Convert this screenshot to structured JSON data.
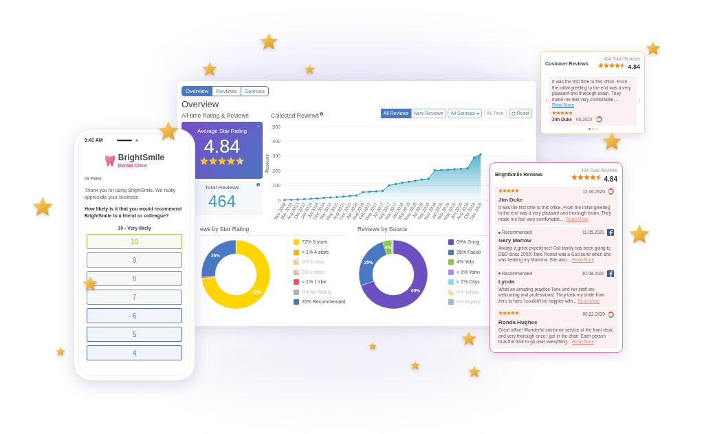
{
  "dashboard": {
    "tabs": [
      {
        "label": "Overview",
        "selected": true
      },
      {
        "label": "Reviews",
        "selected": false
      },
      {
        "label": "Sources",
        "selected": false
      }
    ],
    "heading": "Overview",
    "rating_title": "All-time Rating & Reviews",
    "average": {
      "label": "Average Star Rating",
      "value": "4.84",
      "stars": 4.5
    },
    "total": {
      "label": "Total Reviews",
      "value": "464"
    },
    "collected": {
      "title": "Collected Reviews",
      "filters": [
        {
          "label": "All Reviews",
          "kind": "toggle",
          "selected": true
        },
        {
          "label": "New Reviews",
          "kind": "toggle",
          "selected": false
        },
        {
          "label": "All Sources",
          "kind": "dropdown"
        },
        {
          "label": "All Time",
          "kind": "plain"
        },
        {
          "label": "Reset",
          "kind": "reset"
        }
      ],
      "chart_data": {
        "type": "area",
        "grid": true,
        "ylabel": "Reviews",
        "ylim": [
          0,
          500
        ],
        "yticks": [
          0,
          100,
          200,
          300,
          400,
          500
        ],
        "categories": [
          "Nov 2008",
          "Mar 2010",
          "Aug 2013",
          "Oct 2013",
          "Jan 2014",
          "Jul 2014",
          "Dec 2014",
          "Mar 2015",
          "May 2015",
          "Aug 2015",
          "Dec 2015",
          "Apr 2016",
          "Aug 2016",
          "Feb 2017",
          "May 2017",
          "Jul 2017",
          "Sep 2017",
          "Nov 2017",
          "Jan 2018",
          "Mar 2018",
          "May 2018",
          "Jul 2018",
          "Sep 2018",
          "Nov 2018",
          "Jan 2019",
          "Mar 2019",
          "May 2019",
          "Jun 2019",
          "Aug 2019",
          "Oct 2019",
          "Dec 2019"
        ],
        "values": [
          1,
          3,
          5,
          7,
          9,
          12,
          15,
          18,
          21,
          25,
          29,
          31,
          55,
          57,
          60,
          63,
          100,
          110,
          118,
          125,
          132,
          140,
          145,
          203,
          205,
          207,
          210,
          213,
          216,
          290,
          310
        ]
      }
    },
    "star_rating": {
      "title": "ews by Star Rating",
      "hatched": [
        false,
        false,
        true,
        true,
        false,
        false,
        false
      ],
      "chart_data": {
        "type": "donut",
        "categories": [
          "72% 5 stars",
          "< 1% 4 stars",
          "0% 3 stars",
          "0% 2 stars",
          "< 1% 1 star",
          "0% No Rating",
          "26% Recommended"
        ],
        "values": [
          72,
          0.5,
          0,
          0,
          0.5,
          0,
          26
        ],
        "value_labels": [
          "72%",
          null,
          null,
          null,
          null,
          null,
          "26%"
        ],
        "colors": [
          "#ffd600",
          "#ffb300",
          "#ffb74d",
          "#ff8a65",
          "#e05a5a",
          "#b0b0b0",
          "#4a78c2"
        ]
      }
    },
    "by_source": {
      "title": "Reviews by Source",
      "hatched": [
        false,
        false,
        false,
        false,
        false,
        true,
        false
      ],
      "chart_data": {
        "type": "donut",
        "categories": [
          "69% Goog",
          "25% Faceb",
          "4% Yelp",
          "< 1% Yaho",
          "< 1% Citys",
          "0% Yellow",
          "0% Superp"
        ],
        "values": [
          69,
          25,
          4,
          0.5,
          0.5,
          0,
          0
        ],
        "value_labels": [
          "69%",
          "25%",
          "4%",
          null,
          null,
          null,
          null
        ],
        "colors": [
          "#6c4fc0",
          "#4a78c2",
          "#8cc63f",
          "#b388ff",
          "#7fe0f5",
          "#ffc870",
          "#a8b4c8"
        ]
      }
    }
  },
  "phone": {
    "time": "9:41 AM",
    "brand": "BrightSmile",
    "brand_sub": "Dental Clinic",
    "greeting": "Hi Peter",
    "message": "Thank you for using BrightSmile. We really appreciate your business.",
    "question": "How likely is it that you would recommend BrightSmile to a friend or colleague?",
    "scale_label": "10 - Very likely",
    "options": [
      {
        "label": "10",
        "color": "#8bc34a"
      },
      {
        "label": "9",
        "color": "#8a8f86"
      },
      {
        "label": "8",
        "color": "#8a8f86"
      },
      {
        "label": "7",
        "color": "#7d8791"
      },
      {
        "label": "6",
        "color": "#4a6fc4"
      },
      {
        "label": "5",
        "color": "#4a6fc4"
      },
      {
        "label": "4",
        "color": "#4a6fc4"
      }
    ]
  },
  "carousel": {
    "title": "Customer Reviews",
    "total": "464 Total Reviews",
    "stars": 4.5,
    "score": "4.84",
    "review": {
      "text": "It was the first time to this office. From the initial greeting to the end was a very pleasant and thorough exam. They made me feel very comfortable,...",
      "link": "Read More",
      "stars": 5,
      "name": "Jim Duke",
      "date": "06.2020",
      "kind": "google"
    },
    "prev": "‹",
    "next": "›",
    "dots": [
      {
        "selected": true
      },
      {
        "selected": false
      },
      {
        "selected": false
      }
    ]
  },
  "widget": {
    "title": "BrightSmile Reviews",
    "total": "464 Total Reviews",
    "stars": 4.5,
    "score": "4.84",
    "reviews": [
      {
        "kind": "google",
        "rating": {
          "stars": 5
        },
        "date": "12.06.2020",
        "name": "Jim Duke",
        "text": "It was the first time to this office. From the initial greeting to the end was a very pleasant and thorough exam. They made me feel very comfortable,...",
        "link": "Read More"
      },
      {
        "kind": "facebook",
        "badge": "Recommended",
        "date": "11.05.2020",
        "name": "Gary Marlow",
        "text": "Always a great experience! Our family has been going to DBD since 2009! Tane Rontal was a God send when she was treating my Momma. She also...",
        "link": "Read More"
      },
      {
        "kind": "facebook",
        "badge": "Recommended",
        "date": "10.08.2020",
        "name": "Lynda",
        "text": "What an amazing practice Tane and her staff are welcoming and professional. They took my smile from zero to hero I couldn't be happier with...",
        "link": "Read More"
      },
      {
        "kind": "google",
        "rating": {
          "stars": 5
        },
        "date": "09.22.2020",
        "name": "Ronda Hughes",
        "text": "Great office! Wonderful customer service at the front desk and very thorough once I got in the chair. Each person took the time to go over everything...",
        "link": "Read More"
      }
    ]
  }
}
